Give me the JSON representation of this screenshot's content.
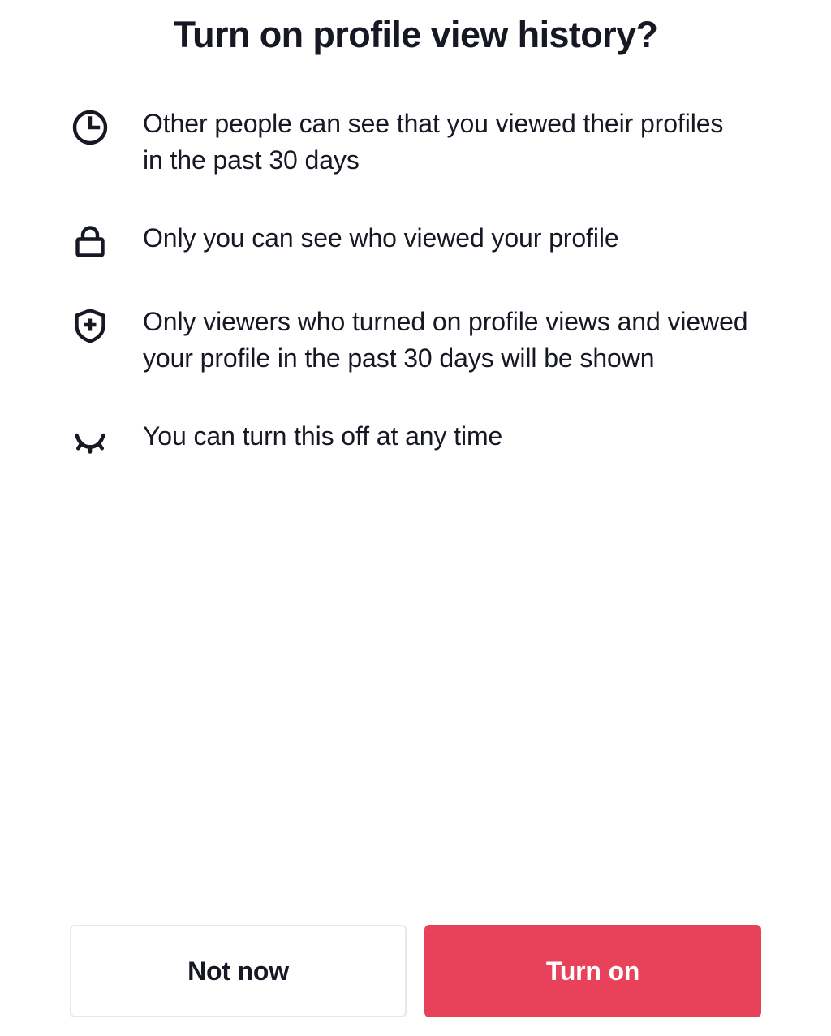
{
  "dialog": {
    "title": "Turn on profile view history?",
    "benefits": [
      {
        "icon": "clock-icon",
        "text": "Other people can see that you viewed their profiles in the past 30 days"
      },
      {
        "icon": "lock-icon",
        "text": "Only you can see who viewed your profile"
      },
      {
        "icon": "shield-plus-icon",
        "text": "Only viewers who turned on profile views and viewed your profile in the past 30 days will be shown"
      },
      {
        "icon": "eye-closed-icon",
        "text": "You can turn this off at any time"
      }
    ],
    "buttons": {
      "secondary_label": "Not now",
      "primary_label": "Turn on"
    },
    "colors": {
      "primary_accent": "#e8415a",
      "text": "#161823",
      "border": "#e8e8ea",
      "background": "#ffffff"
    }
  }
}
